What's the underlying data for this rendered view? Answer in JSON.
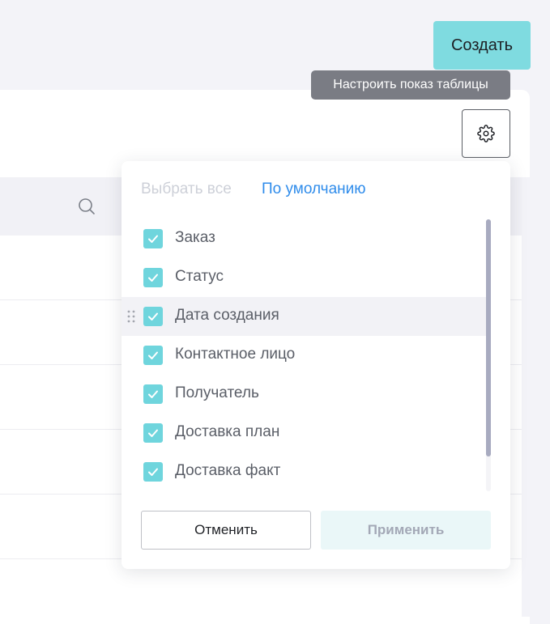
{
  "header": {
    "create_label": "Создать"
  },
  "tooltip": {
    "text": "Настроить показ таблицы"
  },
  "table": {
    "settings_icon": "gear-icon",
    "search_icon": "search-icon"
  },
  "column_settings": {
    "select_all_label": "Выбрать все",
    "default_label": "По умолчанию",
    "columns": [
      {
        "label": "Заказ",
        "checked": true
      },
      {
        "label": "Статус",
        "checked": true
      },
      {
        "label": "Дата создания",
        "checked": true,
        "hovered": true
      },
      {
        "label": "Контактное лицо",
        "checked": true
      },
      {
        "label": "Получатель",
        "checked": true
      },
      {
        "label": "Доставка план",
        "checked": true
      },
      {
        "label": "Доставка факт",
        "checked": true
      }
    ],
    "cancel_label": "Отменить",
    "apply_label": "Применить"
  },
  "colors": {
    "accent": "#7fdbe0",
    "checkbox": "#6fd5dd",
    "link": "#2f8ceb",
    "tooltip_bg": "#7a7c84"
  }
}
